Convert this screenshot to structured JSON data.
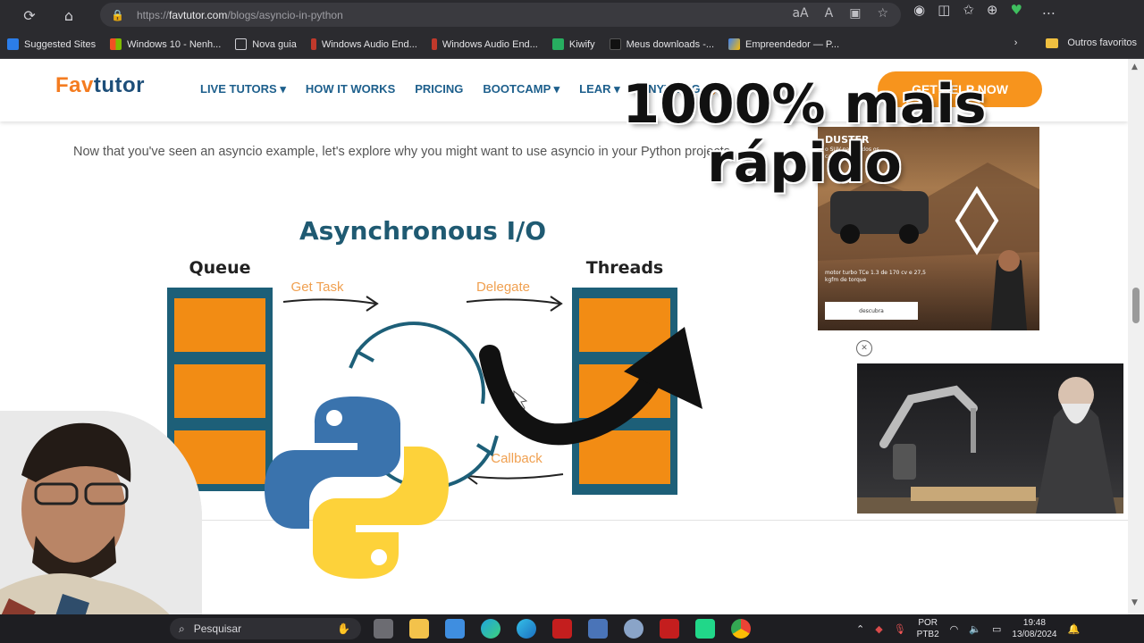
{
  "browser": {
    "url_prefix": "https://",
    "url_domain": "favtutor.com",
    "url_path": "/blogs/asyncio-in-python",
    "bookmarks": [
      {
        "label": "Suggested Sites",
        "color": "#2b7de9"
      },
      {
        "label": "Windows 10 - Nenh...",
        "color": "#e74c3c"
      },
      {
        "label": "Nova guia",
        "color": "#cfcfd4"
      },
      {
        "label": "Windows Audio End...",
        "color": "#c0392b"
      },
      {
        "label": "Windows Audio End...",
        "color": "#c0392b"
      },
      {
        "label": "Kiwify",
        "color": "#27ae60"
      },
      {
        "label": "Meus downloads -...",
        "color": "#111111"
      },
      {
        "label": "Empreendedor — P...",
        "color": "#3b82f6"
      }
    ],
    "other_favorites": "Outros favoritos"
  },
  "site": {
    "logo_fav": "Fav",
    "logo_tutor": "tutor",
    "nav": [
      "LIVE TUTORS ▾",
      "HOW IT WORKS",
      "PRICING",
      "BOOTCAMP ▾",
      "LEAR ▾",
      "ANYTHING 🔥"
    ],
    "cta": "GET HELP NOW",
    "intro": "Now that you've seen an asyncio example, let's explore why you might want to use asyncio in your Python projects."
  },
  "diagram": {
    "title": "Asynchronous I/O",
    "queue_label": "Queue",
    "threads_label": "Threads",
    "get_task": "Get Task",
    "delegate": "Delegate",
    "callback": "Callback",
    "colors": {
      "title": "#1f5a72",
      "block": "#f28c14",
      "frame": "#1d5f78",
      "arrow_label": "#f0a050"
    }
  },
  "ads": {
    "ad1_brand": "DUSTER",
    "ad1_tag": "o SUV para todos os caminhos",
    "ad1_text": "motor turbo TCe 1.3 de 170 cv e 27,5 kgfm de torque",
    "ad1_button": "descubra",
    "close": "✕"
  },
  "overlay": {
    "headline_line1": "1000% mais",
    "headline_line2": "rápido"
  },
  "taskbar": {
    "search_placeholder": "Pesquisar",
    "lang_top": "POR",
    "lang_bottom": "PTB2",
    "time": "19:48",
    "date": "13/08/2024"
  }
}
